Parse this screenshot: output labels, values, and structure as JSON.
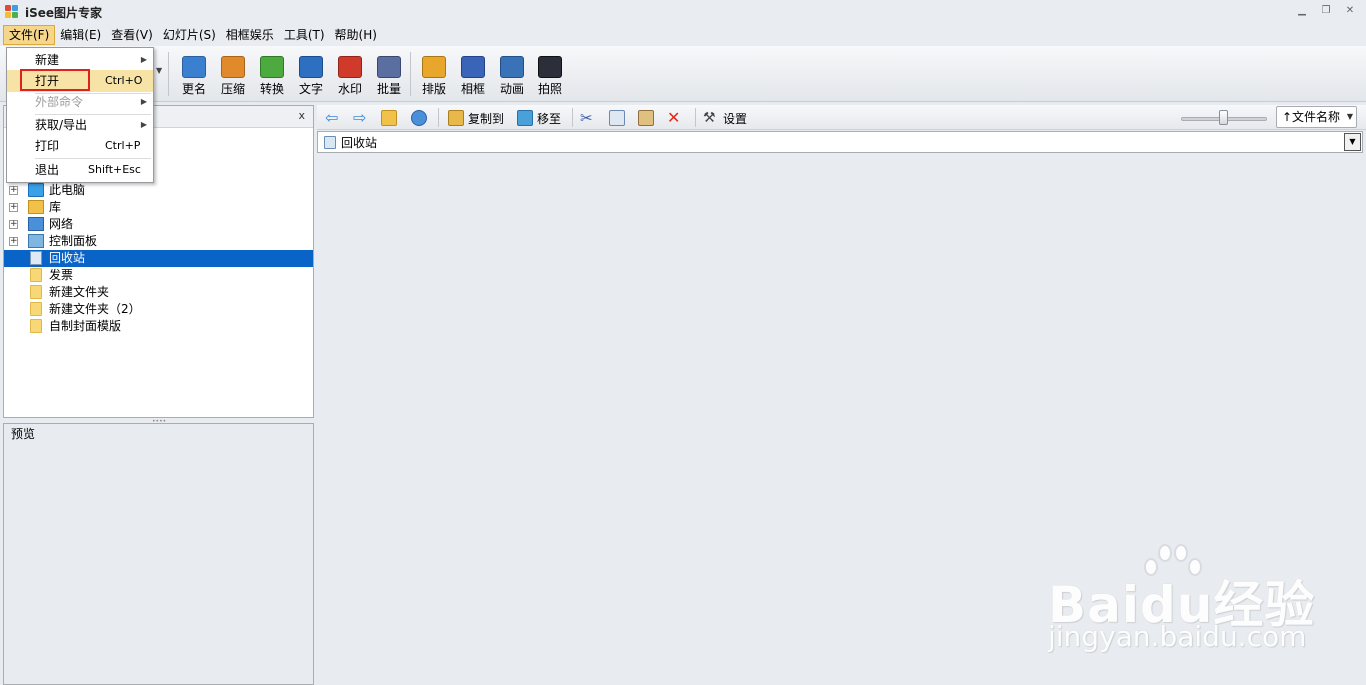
{
  "window": {
    "title": "iSee图片专家"
  },
  "menubar": [
    "文件(F)",
    "编辑(E)",
    "查看(V)",
    "幻灯片(S)",
    "相框娱乐",
    "工具(T)",
    "帮助(H)"
  ],
  "toolbar": {
    "buttons": [
      {
        "label": "更名",
        "icon": "rename-icon",
        "color": "#3a7fd0"
      },
      {
        "label": "压缩",
        "icon": "compress-icon",
        "color": "#e08a2c"
      },
      {
        "label": "转换",
        "icon": "convert-icon",
        "color": "#4caa3e"
      },
      {
        "label": "文字",
        "icon": "text-icon",
        "color": "#2d6fc0"
      },
      {
        "label": "水印",
        "icon": "watermark-icon",
        "color": "#d03a2a"
      },
      {
        "label": "批量",
        "icon": "batch-icon",
        "color": "#5b6ea0"
      },
      {
        "label": "排版",
        "icon": "layout-icon",
        "color": "#e8a62a"
      },
      {
        "label": "相框",
        "icon": "photo-frame-icon",
        "color": "#3a64b8"
      },
      {
        "label": "动画",
        "icon": "animation-icon",
        "color": "#3a72b8"
      },
      {
        "label": "拍照",
        "icon": "camera-icon",
        "color": "#2b2f3a"
      }
    ]
  },
  "file_menu": {
    "items": [
      {
        "label": "新建",
        "shortcut": "",
        "submenu": true,
        "disabled": false
      },
      {
        "label": "打开",
        "shortcut": "Ctrl+O",
        "submenu": false,
        "disabled": false
      },
      {
        "label": "外部命令",
        "shortcut": "",
        "submenu": true,
        "disabled": true
      },
      {
        "label": "获取/导出",
        "shortcut": "",
        "submenu": true,
        "disabled": false
      },
      {
        "label": "打印",
        "shortcut": "Ctrl+P",
        "submenu": false,
        "disabled": false
      },
      {
        "label": "退出",
        "shortcut": "Shift+Esc",
        "submenu": false,
        "disabled": false
      }
    ]
  },
  "left_panel": {
    "close": "x",
    "tree": [
      {
        "label": "此电脑",
        "expandable": true,
        "icon": "computer-icon",
        "selected": false
      },
      {
        "label": "库",
        "expandable": true,
        "icon": "library-icon",
        "selected": false
      },
      {
        "label": "网络",
        "expandable": true,
        "icon": "network-icon",
        "selected": false
      },
      {
        "label": "控制面板",
        "expandable": true,
        "icon": "control-panel-icon",
        "selected": false
      },
      {
        "label": "回收站",
        "expandable": false,
        "icon": "recycle-bin-icon",
        "selected": true
      },
      {
        "label": "发票",
        "expandable": false,
        "icon": "folder-icon",
        "selected": false
      },
      {
        "label": "新建文件夹",
        "expandable": false,
        "icon": "folder-icon",
        "selected": false
      },
      {
        "label": "新建文件夹（2）",
        "expandable": false,
        "icon": "folder-icon",
        "selected": false
      },
      {
        "label": "自制封面模版",
        "expandable": false,
        "icon": "folder-icon",
        "selected": false
      }
    ]
  },
  "preview": {
    "title": "预览"
  },
  "right_toolbar": {
    "copy_to": "复制到",
    "move_to": "移至",
    "settings": "设置",
    "sort_label": "↑文件名称"
  },
  "address": {
    "path": "回收站"
  },
  "watermark": {
    "big": "Baidu经验",
    "small": "jingyan.baidu.com"
  }
}
